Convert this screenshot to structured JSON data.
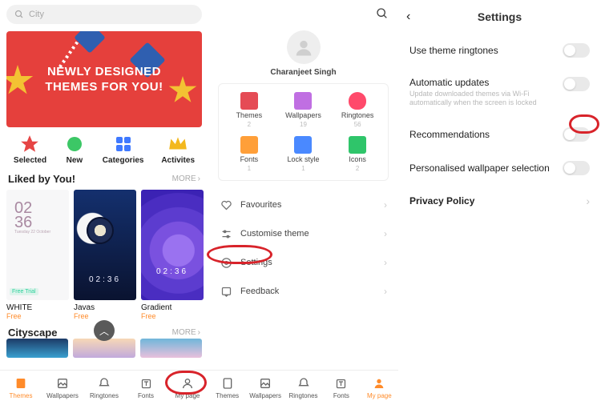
{
  "pane1": {
    "search_placeholder": "City",
    "banner_line1": "Newly Designed",
    "banner_line2": "Themes For You!",
    "cats": [
      "Selected",
      "New",
      "Categories",
      "Activites"
    ],
    "liked_title": "Liked by You!",
    "more": "MORE",
    "themes": [
      {
        "name": "WHITE",
        "price": "Free",
        "time_big1": "02",
        "time_big2": "36",
        "weekday": "Tuesday 22 October",
        "badge": "Free Trial"
      },
      {
        "name": "Javas",
        "price": "Free",
        "time": "02:36"
      },
      {
        "name": "Gradient",
        "price": "Free",
        "time": "02:36"
      }
    ],
    "cityscape_title": "Cityscape",
    "tabs": [
      "Themes",
      "Wallpapers",
      "Ringtones",
      "Fonts",
      "My page"
    ]
  },
  "pane2": {
    "username": "Charanjeet Singh",
    "grid": [
      {
        "label": "Themes",
        "count": "2",
        "color": "#e54b55"
      },
      {
        "label": "Wallpapers",
        "count": "19",
        "color": "#c06fe2"
      },
      {
        "label": "Ringtones",
        "count": "56",
        "color": "#ff4a6b"
      },
      {
        "label": "Fonts",
        "count": "1",
        "color": "#ff9f39"
      },
      {
        "label": "Lock style",
        "count": "1",
        "color": "#4a89ff"
      },
      {
        "label": "Icons",
        "count": "2",
        "color": "#2fc56a"
      }
    ],
    "menu": [
      "Favourites",
      "Customise theme",
      "Settings",
      "Feedback"
    ],
    "tabs": [
      "Themes",
      "Wallpapers",
      "Ringtones",
      "Fonts",
      "My page"
    ]
  },
  "pane3": {
    "title": "Settings",
    "rows": [
      {
        "label": "Use theme ringtones",
        "type": "toggle"
      },
      {
        "label": "Automatic updates",
        "sub": "Update downloaded themes via Wi-Fi automatically when the screen is locked",
        "type": "toggle"
      },
      {
        "label": "Recommendations",
        "type": "toggle",
        "highlight": true
      },
      {
        "label": "Personalised wallpaper selection",
        "type": "toggle"
      },
      {
        "label": "Privacy Policy",
        "type": "chevron"
      }
    ]
  }
}
